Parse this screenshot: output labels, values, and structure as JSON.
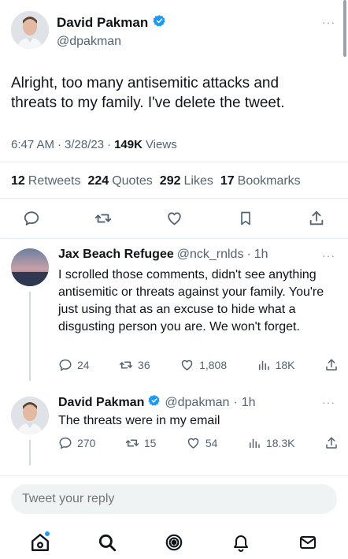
{
  "tweet": {
    "author_name": "David Pakman",
    "author_handle": "@dpakman",
    "text": "Alright, too many antisemitic attacks and threats to my family. I've delete the tweet.",
    "time": "6:47 AM",
    "date": "3/28/23",
    "views_count": "149K",
    "views_label": "Views",
    "sep": "·",
    "stats": {
      "retweets_count": "12",
      "retweets_label": "Retweets",
      "quotes_count": "224",
      "quotes_label": "Quotes",
      "likes_count": "292",
      "likes_label": "Likes",
      "bookmarks_count": "17",
      "bookmarks_label": "Bookmarks"
    },
    "more": "···"
  },
  "replies": [
    {
      "author_name": "Jax Beach Refugee",
      "author_handle": "@nck_rnlds",
      "sep": "·",
      "age": "1h",
      "text": "I scrolled those comments, didn't see anything antisemitic or threats against your family. You're just using that as an excuse to hide what a disgusting person you are.  We won't forget.",
      "replies": "24",
      "retweets": "36",
      "likes": "1,808",
      "views": "18K",
      "more": "···"
    },
    {
      "author_name": "David Pakman",
      "author_handle": "@dpakman",
      "sep": "·",
      "age": "1h",
      "text": "The threats were in my email",
      "replies": "270",
      "retweets": "15",
      "likes": "54",
      "views": "18.3K",
      "more": "···"
    }
  ],
  "composer": {
    "placeholder": "Tweet your reply"
  },
  "nav": {
    "icons": [
      "home-icon",
      "search-icon",
      "spaces-icon",
      "notifications-icon",
      "messages-icon"
    ]
  },
  "colors": {
    "accent": "#1d9bf0",
    "text": "#0f1419",
    "muted": "#536471"
  }
}
